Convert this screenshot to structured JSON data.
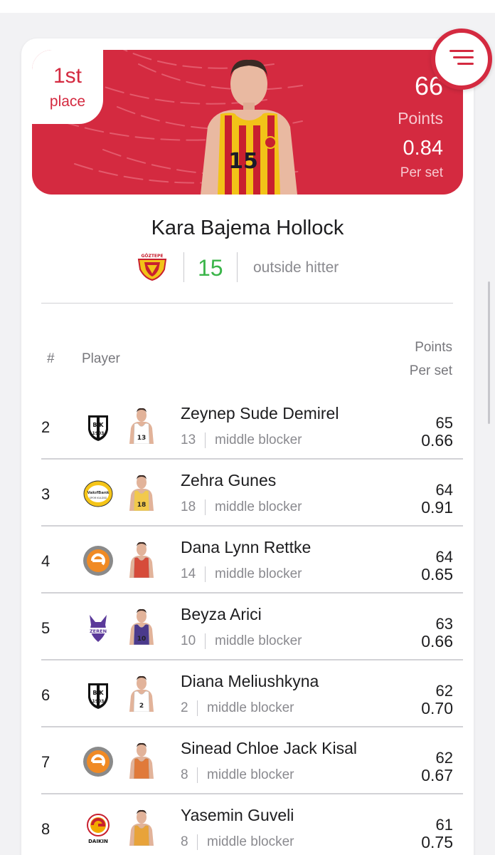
{
  "hero": {
    "place_number": "1st",
    "place_word": "place",
    "points_value": "66",
    "points_label": "Points",
    "per_set_value": "0.84",
    "per_set_label": "Per set",
    "jersey_number": "15",
    "accent_color": "#d42a40"
  },
  "player": {
    "name": "Kara Bajema Hollock",
    "number": "15",
    "position": "outside hitter",
    "number_color": "#3bb54a",
    "team_icon": "goztepe-crest-icon"
  },
  "table": {
    "col_rank": "#",
    "col_player": "Player",
    "col_points": "Points",
    "col_per_set": "Per set",
    "rows": [
      {
        "rank": "2",
        "name": "Zeynep Sude Demirel",
        "number": "13",
        "position": "middle blocker",
        "points": "65",
        "per_set": "0.66",
        "team_icon": "besiktas-logo-icon",
        "kit": "#ffffff",
        "kit_number": "13"
      },
      {
        "rank": "3",
        "name": "Zehra Gunes",
        "number": "18",
        "position": "middle blocker",
        "points": "64",
        "per_set": "0.91",
        "team_icon": "vakifbank-logo-icon",
        "kit": "#f2c94c",
        "kit_number": "18"
      },
      {
        "rank": "4",
        "name": "Dana Lynn Rettke",
        "number": "14",
        "position": "middle blocker",
        "points": "64",
        "per_set": "0.65",
        "team_icon": "eczacibasi-logo-icon",
        "kit": "#d64b3a",
        "kit_number": ""
      },
      {
        "rank": "5",
        "name": "Beyza Arici",
        "number": "10",
        "position": "middle blocker",
        "points": "63",
        "per_set": "0.66",
        "team_icon": "zeren-logo-icon",
        "kit": "#4b3a8c",
        "kit_number": "10"
      },
      {
        "rank": "6",
        "name": "Diana Meliushkyna",
        "number": "2",
        "position": "middle blocker",
        "points": "62",
        "per_set": "0.70",
        "team_icon": "besiktas-logo-icon",
        "kit": "#ffffff",
        "kit_number": "2"
      },
      {
        "rank": "7",
        "name": "Sinead Chloe Jack Kisal",
        "number": "8",
        "position": "middle blocker",
        "points": "62",
        "per_set": "0.67",
        "team_icon": "eczacibasi-logo-icon",
        "kit": "#e07a3a",
        "kit_number": ""
      },
      {
        "rank": "8",
        "name": "Yasemin Guveli",
        "number": "8",
        "position": "middle blocker",
        "points": "61",
        "per_set": "0.75",
        "team_icon": "galatasaray-daikin-logo-icon",
        "kit": "#e8a33a",
        "kit_number": ""
      }
    ]
  },
  "logo_text": {
    "bjk": "BJK",
    "bjk_year": "1903",
    "vakifbank": "VakıfBank",
    "vakifbank_sub": "SPOR KULÜBÜ",
    "zeren": "ZEREN",
    "daikin": "DAIKIN",
    "goztepe": "GÖZTEPE"
  }
}
